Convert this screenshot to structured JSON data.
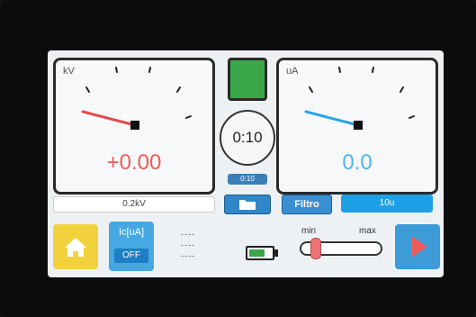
{
  "meters": {
    "left": {
      "unit": "kV",
      "value": "+0.00",
      "needle_color": "#e34b4b",
      "value_color": "#ee5b5b"
    },
    "right": {
      "unit": "uA",
      "value": "0.0",
      "needle_color": "#2aa3e4",
      "value_color": "#4ab7ea"
    }
  },
  "range_label": "0.2kV",
  "timer": {
    "main": "0:10",
    "small": "0:10"
  },
  "filtro_label": "Filtro",
  "filter_value": "10u",
  "ic": {
    "label": "Ic[uA]",
    "state": "OFF"
  },
  "dashes": [
    "----",
    "----",
    "----"
  ],
  "slider": {
    "min_label": "min",
    "max_label": "max",
    "level": 0.15
  },
  "battery_level": 0.7,
  "icons": {
    "home": "home-icon",
    "folder": "folder-icon",
    "play": "play-icon",
    "battery": "battery-icon"
  },
  "colors": {
    "green_indicator": "#3aa64a",
    "home_button": "#f2d23c",
    "play_arrow": "#f05b5b",
    "accent_blue": "#1ea0e6"
  }
}
